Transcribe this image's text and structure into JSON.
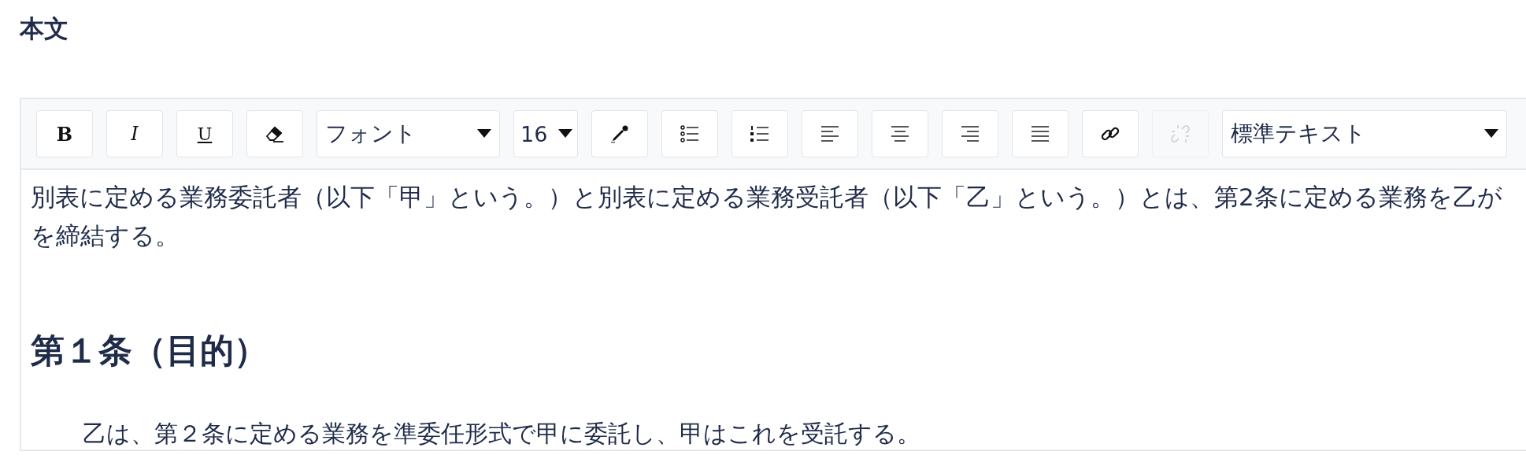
{
  "field_label": "本文",
  "toolbar": [
    {
      "kind": "bold",
      "text": "B",
      "disabled": false
    },
    {
      "kind": "italic",
      "text": "I",
      "disabled": false
    },
    {
      "kind": "underline",
      "text": "U",
      "disabled": false
    },
    {
      "kind": "eraser",
      "disabled": false
    },
    {
      "kind": "font-select",
      "value": "フォント"
    },
    {
      "kind": "size-select",
      "value": "16"
    },
    {
      "kind": "color",
      "disabled": false
    },
    {
      "kind": "bullet-list",
      "disabled": false
    },
    {
      "kind": "number-list",
      "disabled": false
    },
    {
      "kind": "align-left",
      "disabled": false
    },
    {
      "kind": "align-center",
      "disabled": false
    },
    {
      "kind": "align-right",
      "disabled": false
    },
    {
      "kind": "justify",
      "disabled": false
    },
    {
      "kind": "link",
      "disabled": false
    },
    {
      "kind": "unlink",
      "disabled": true
    },
    {
      "kind": "style-select",
      "value": "標準テキスト"
    }
  ],
  "content": [
    {
      "kind": "paragraph",
      "text": "別表に定める業務委託者（以下「甲」という。）と別表に定める業務受託者（以下「乙」という。）とは、第2条に定める業務を乙がを締結する。"
    },
    {
      "kind": "heading",
      "text": "第１条（目的）"
    },
    {
      "kind": "indented",
      "text": "乙は、第２条に定める業務を準委任形式で甲に委託し、甲はこれを受託する。"
    }
  ]
}
